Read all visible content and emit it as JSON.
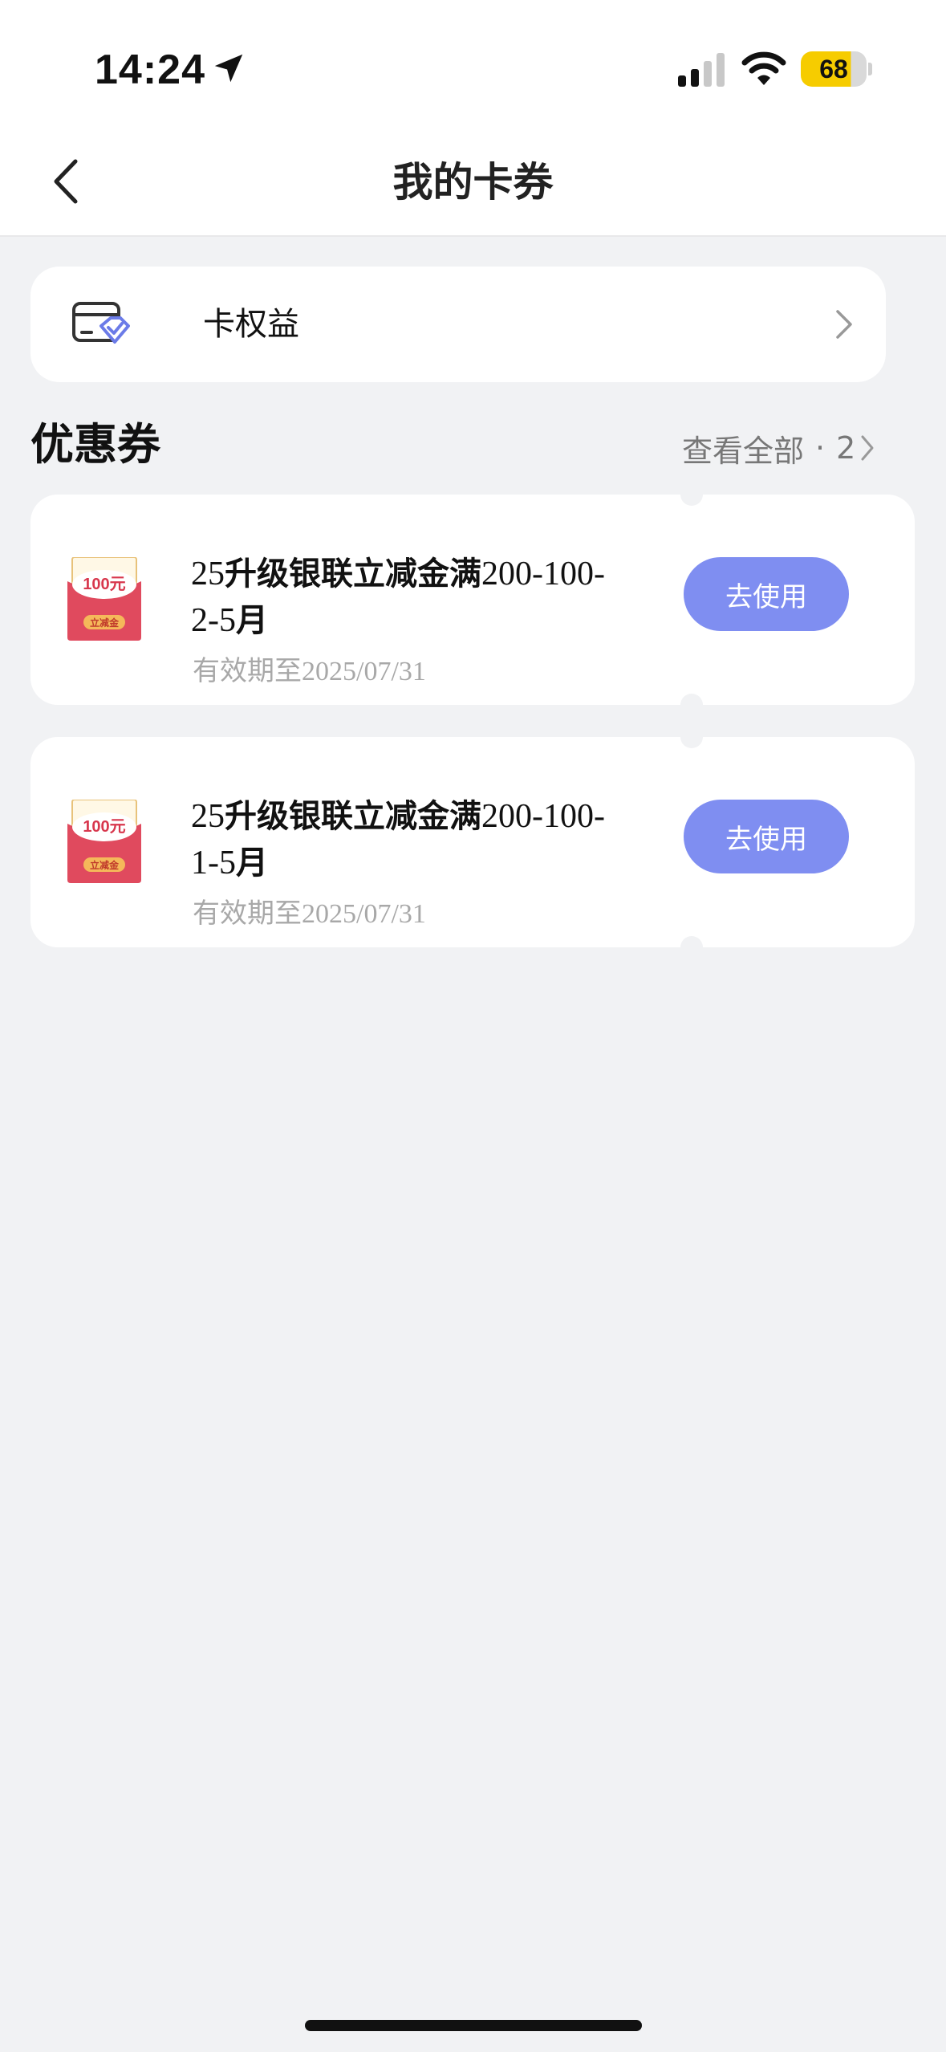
{
  "status_bar": {
    "time": "14:24",
    "battery": "68"
  },
  "header": {
    "title": "我的卡券"
  },
  "benefit_row": {
    "label": "卡权益"
  },
  "coupon_section": {
    "title": "优惠券",
    "view_all_label": "查看全部",
    "dot": "·",
    "count": "2"
  },
  "coupons": [
    {
      "title_prefix": "25",
      "title_text": "升级银联立减金满",
      "title_suffix_line1": "200-100-",
      "title_line2": "2-5",
      "title_line2_char": "月",
      "expiry_prefix": "有效期至",
      "expiry_date": "2025/07/31",
      "button_label": "去使用",
      "badge_amount": "100元",
      "badge_tag": "立减金"
    },
    {
      "title_prefix": "25",
      "title_text": "升级银联立减金满",
      "title_suffix_line1": "200-100-",
      "title_line2": "1-5",
      "title_line2_char": "月",
      "expiry_prefix": "有效期至",
      "expiry_date": "2025/07/31",
      "button_label": "去使用",
      "badge_amount": "100元",
      "badge_tag": "立减金"
    }
  ],
  "colors": {
    "page_background": "#f1f2f4",
    "button_accent": "#7f8ef1",
    "battery_fill": "#f6cc00",
    "coupon_badge_red": "#e04a5e"
  },
  "icons": {
    "back": "chevron-left-icon",
    "benefit": "card-benefit-icon",
    "row_arrow": "chevron-right-icon",
    "coupon_badge": "coupon-badge-icon"
  }
}
